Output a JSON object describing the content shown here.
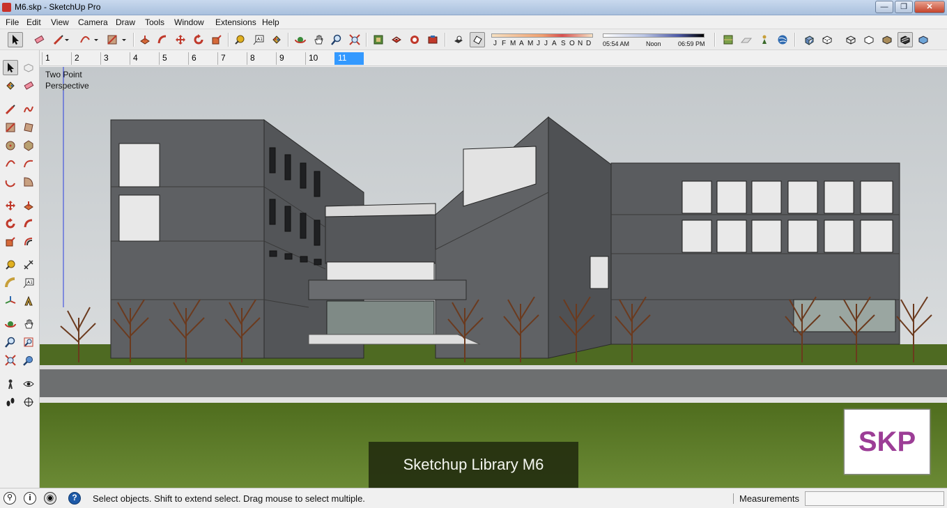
{
  "window": {
    "title": "M6.skp - SketchUp Pro",
    "minimize_glyph": "—",
    "maximize_glyph": "❐",
    "close_glyph": "✕"
  },
  "menu": [
    "File",
    "Edit",
    "View",
    "Camera",
    "Draw",
    "Tools",
    "Window",
    "Extensions",
    "Help"
  ],
  "shadow_settings": {
    "months": [
      "J",
      "F",
      "M",
      "A",
      "M",
      "J",
      "J",
      "A",
      "S",
      "O",
      "N",
      "D"
    ],
    "time_start": "05:54 AM",
    "time_mid": "Noon",
    "time_end": "06:59 PM"
  },
  "scene_tabs": {
    "items": [
      "1",
      "2",
      "3",
      "4",
      "5",
      "6",
      "7",
      "8",
      "9",
      "10",
      "11"
    ],
    "active_index": 10
  },
  "viewport": {
    "camera_label": "Two Point Perspective",
    "camera_label_line1": "Two Point",
    "camera_label_line2": "Perspective",
    "banner_text": "Sketchup Library M6",
    "logo_text": "SKP"
  },
  "status": {
    "hint": "Select objects. Shift to extend select. Drag mouse to select multiple.",
    "measurements_label": "Measurements",
    "measurements_value": "",
    "help_glyph": "?",
    "info_glyph": "i",
    "geo_glyph": "⚲",
    "user_glyph": "◉"
  },
  "colors": {
    "accent_active_tab": "#3399ff",
    "sky": "#cfd3d6",
    "grass": "#5d7a2a",
    "building": "#5b5d60",
    "logo_text": "#9c3d96"
  }
}
